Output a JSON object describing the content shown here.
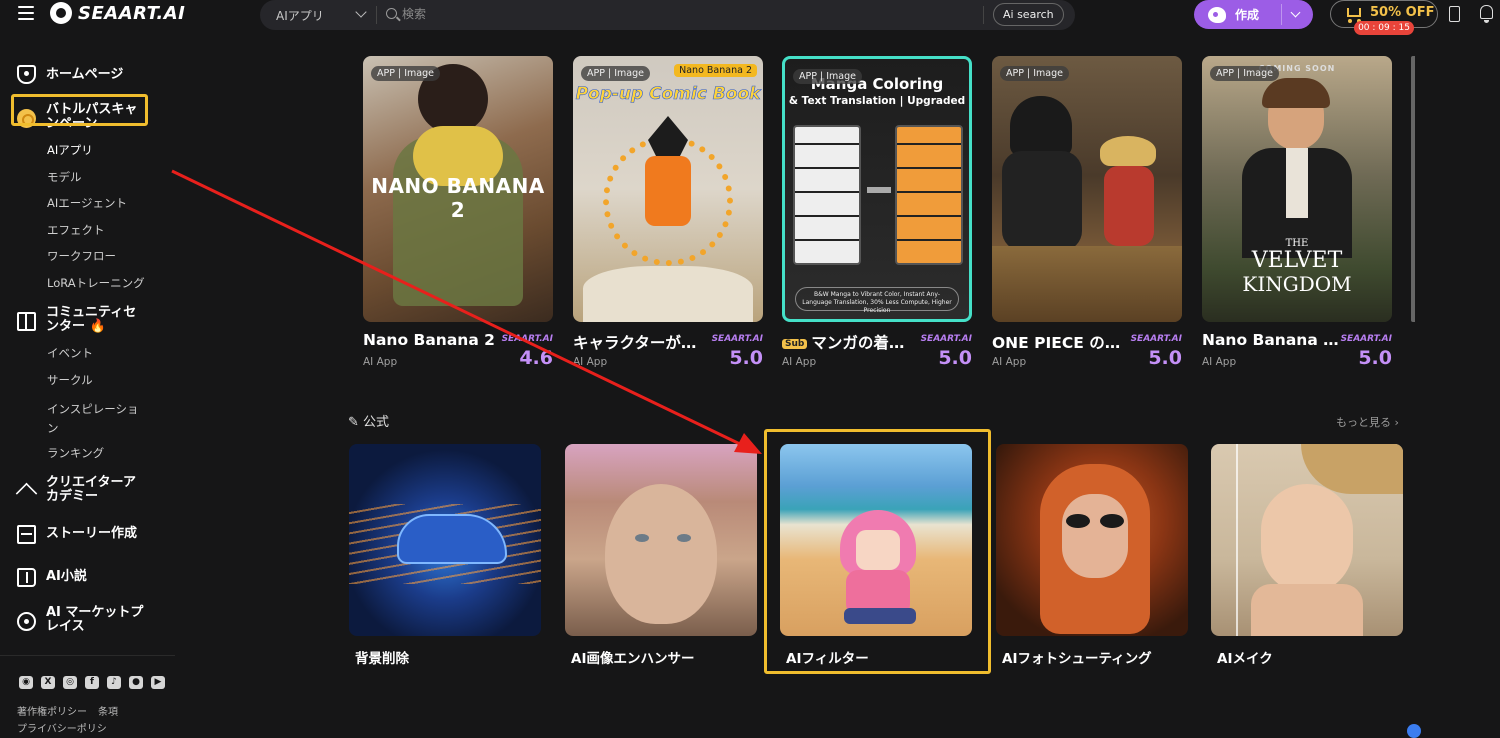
{
  "header": {
    "logo_text": "SEAART.AI",
    "search_category": "AIアプリ",
    "search_placeholder": "検索",
    "ai_search_label": "Ai search",
    "create_label": "作成",
    "promo_label": "50% OFF",
    "promo_timer": "00 : 09 : 15"
  },
  "sidebar": {
    "home": "ホームページ",
    "battle_pass": "バトルパスキャンペーン",
    "sub1": [
      "AIアプリ",
      "モデル",
      "AIエージェント",
      "エフェクト",
      "ワークフロー",
      "LoRAトレーニング"
    ],
    "community": "コミュニティセンター 🔥",
    "sub2": [
      "イベント",
      "サークル",
      "インスピレーション",
      "ランキング"
    ],
    "academy": "クリエイターアカデミー",
    "story": "ストーリー作成",
    "novel": "AI小説",
    "marketplace": "AI マーケットプレイス",
    "footer_links": [
      "著作権ポリシー",
      "条項",
      "プライバシーポリシ"
    ],
    "social_icons": [
      "discord-icon",
      "x-icon",
      "instagram-icon",
      "facebook-icon",
      "tiktok-icon",
      "reddit-icon",
      "youtube-icon"
    ]
  },
  "featured": [
    {
      "badge": "APP | Image",
      "thumb_title": "NANO BANANA 2",
      "title": "Nano Banana 2",
      "sub": "AI App",
      "brand": "SEAART.AI",
      "rating": "4.6"
    },
    {
      "badge": "APP | Image",
      "tag": "Nano Banana 2",
      "thumb_title": "Pop-up Comic Book",
      "title": "キャラクターが…",
      "sub": "AI App",
      "brand": "SEAART.AI",
      "rating": "5.0"
    },
    {
      "badge": "APP | Image",
      "thumb_title": "Manga Coloring",
      "thumb_title2": "& Text Translation | Upgraded",
      "thumb_footer": "B&W Manga to Vibrant Color, Instant Any-Language Translation, 30% Less Compute, Higher Precision",
      "sub_tag": "Sub",
      "title": "マンガの着…",
      "sub": "AI App",
      "brand": "SEAART.AI",
      "rating": "5.0"
    },
    {
      "badge": "APP | Image",
      "title": "ONE PIECE の…",
      "sub": "AI App",
      "brand": "SEAART.AI",
      "rating": "5.0"
    },
    {
      "badge": "APP | Image",
      "coming": "COMING SOON",
      "thumb_title": "THE",
      "thumb_title2": "VELVET",
      "thumb_title3": "KINGDOM",
      "title": "Nano Banana …",
      "sub": "AI App",
      "brand": "SEAART.AI",
      "rating": "5.0"
    }
  ],
  "official": {
    "section_title": "公式",
    "more": "もっと見る",
    "tools": [
      "背景削除",
      "AI画像エンハンサー",
      "AIフィルター",
      "AIフォトシューティング",
      "AIメイク"
    ]
  },
  "colors": {
    "accent": "#9c5de6",
    "highlight": "#f0bd2e",
    "arrow": "#e8201c",
    "rating": "#c490f7"
  }
}
